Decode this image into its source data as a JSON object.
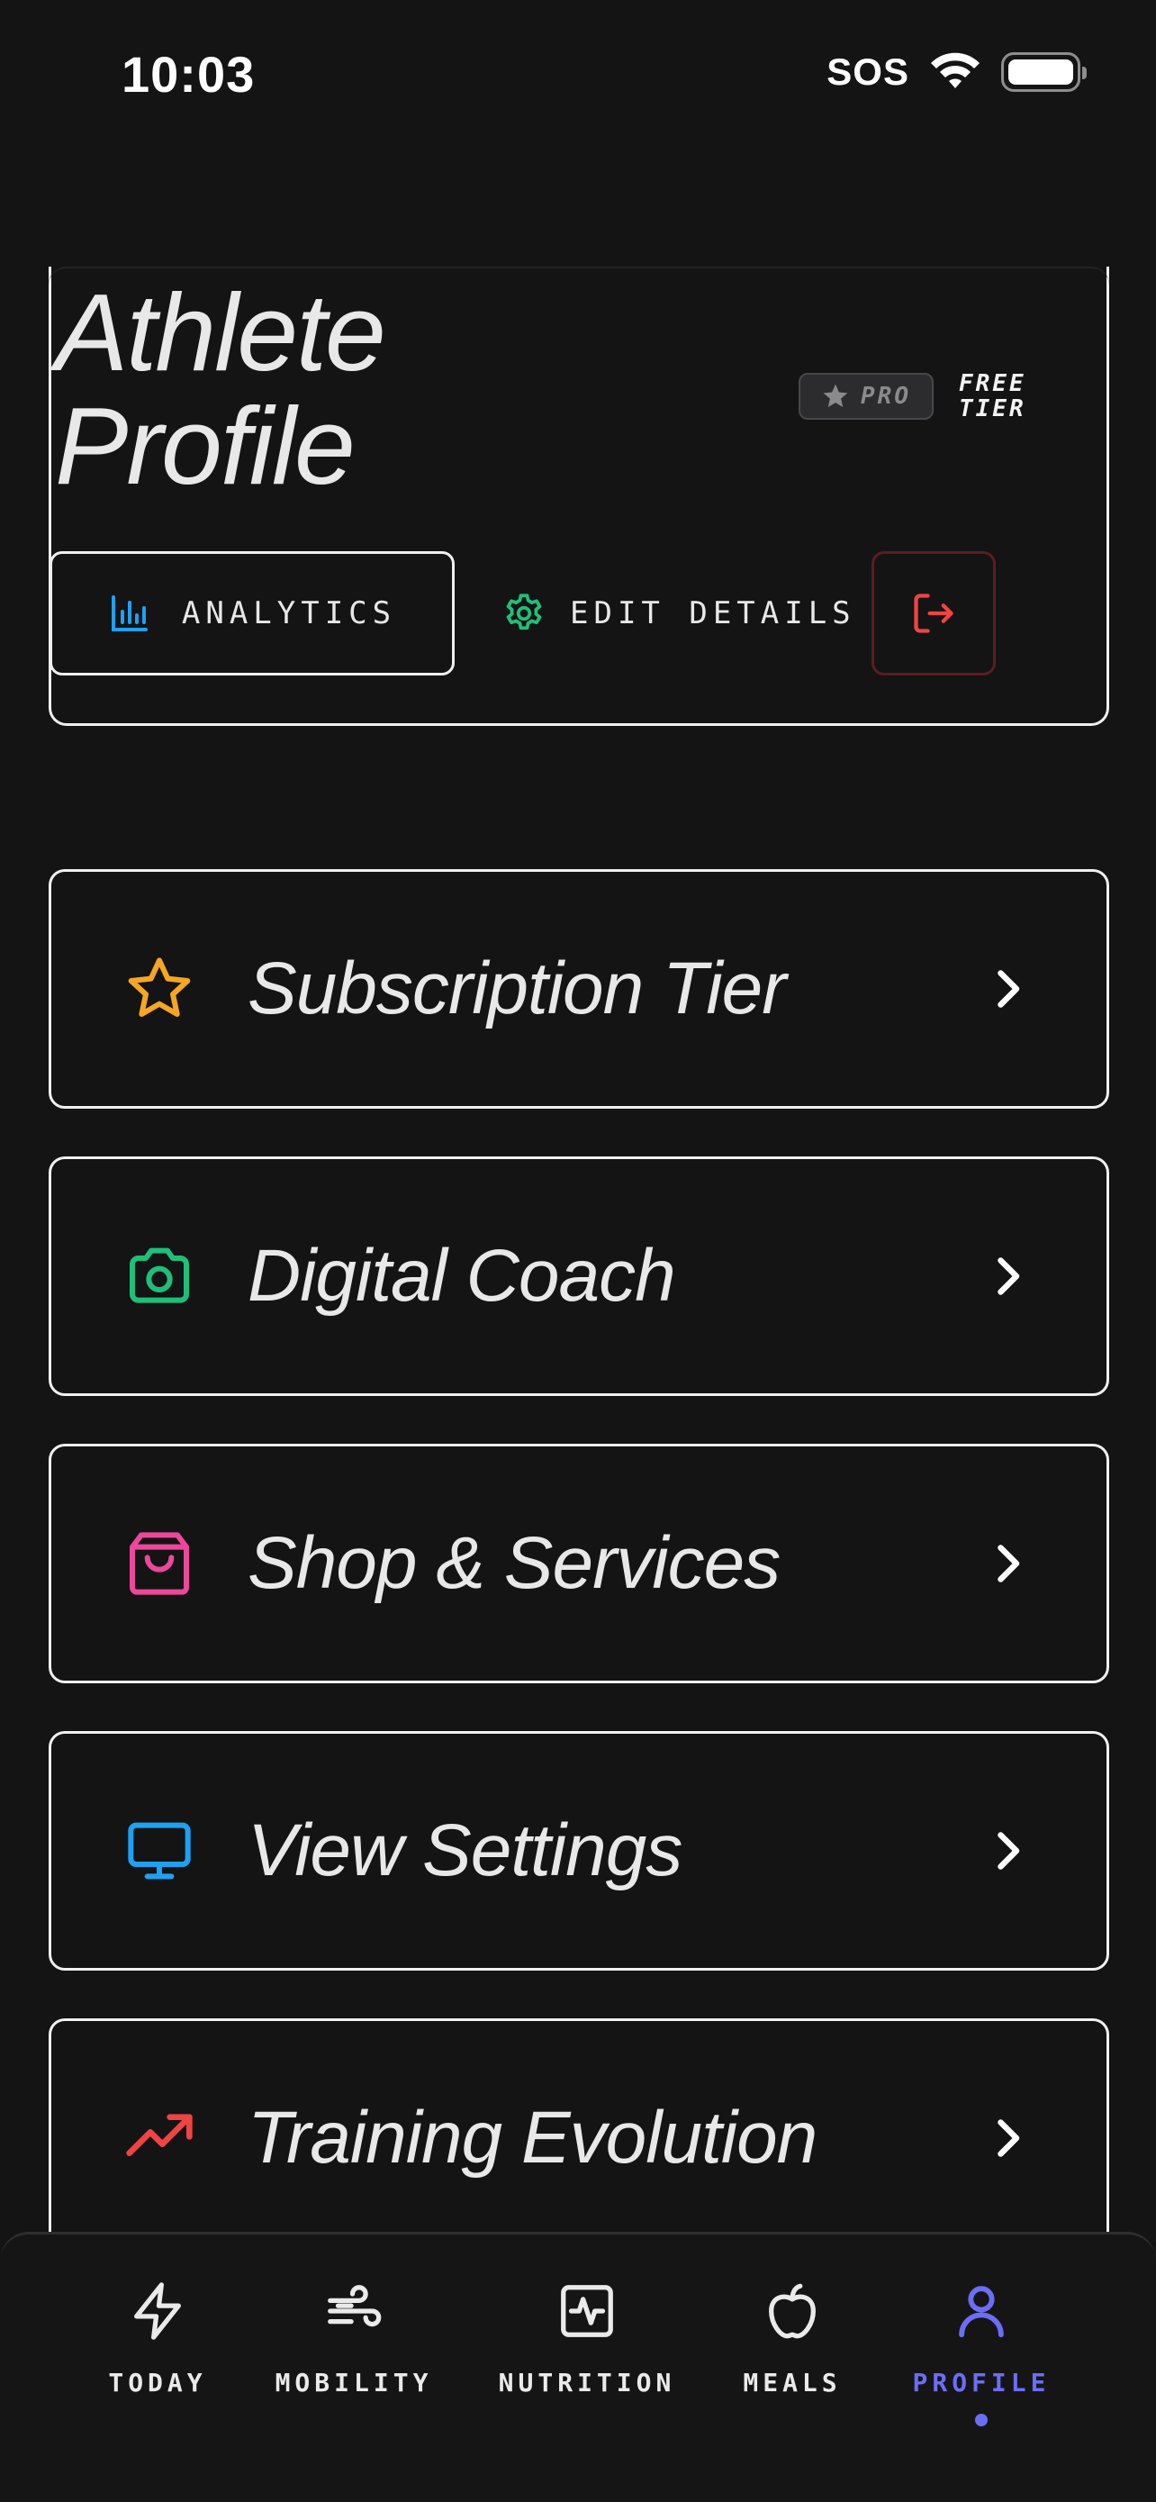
{
  "status_bar": {
    "time": "10:03",
    "carrier": "SOS"
  },
  "header": {
    "title_line1": "Athlete",
    "title_line2": "Profile",
    "badge_label": "PRO",
    "tier_line1": "FREE",
    "tier_line2": "TIER"
  },
  "actions": {
    "analytics_label": "ANALYTICS",
    "edit_label": "EDIT DETAILS"
  },
  "menu": {
    "items": [
      {
        "label": "Subscription Tier",
        "icon": "star-icon",
        "color": "#f5a623"
      },
      {
        "label": "Digital Coach",
        "icon": "camera-icon",
        "color": "#1fbf7a"
      },
      {
        "label": "Shop & Services",
        "icon": "shopping-bag-icon",
        "color": "#ec4899"
      },
      {
        "label": "View Settings",
        "icon": "monitor-icon",
        "color": "#1da1f2"
      },
      {
        "label": "Training Evolution",
        "icon": "trending-up-icon",
        "color": "#ef4444"
      }
    ]
  },
  "tabs": [
    {
      "label": "TODAY",
      "icon": "bolt-icon"
    },
    {
      "label": "MOBILITY",
      "icon": "wind-icon"
    },
    {
      "label": "NUTRITION",
      "icon": "activity-square-icon"
    },
    {
      "label": "MEALS",
      "icon": "apple-icon"
    },
    {
      "label": "PROFILE",
      "icon": "user-icon",
      "active": true
    }
  ],
  "colors": {
    "background": "#141415",
    "accent": "#6b6ef5",
    "analytics_icon": "#1da1f2",
    "edit_icon": "#1fbf7a",
    "logout_icon": "#ef4444"
  }
}
